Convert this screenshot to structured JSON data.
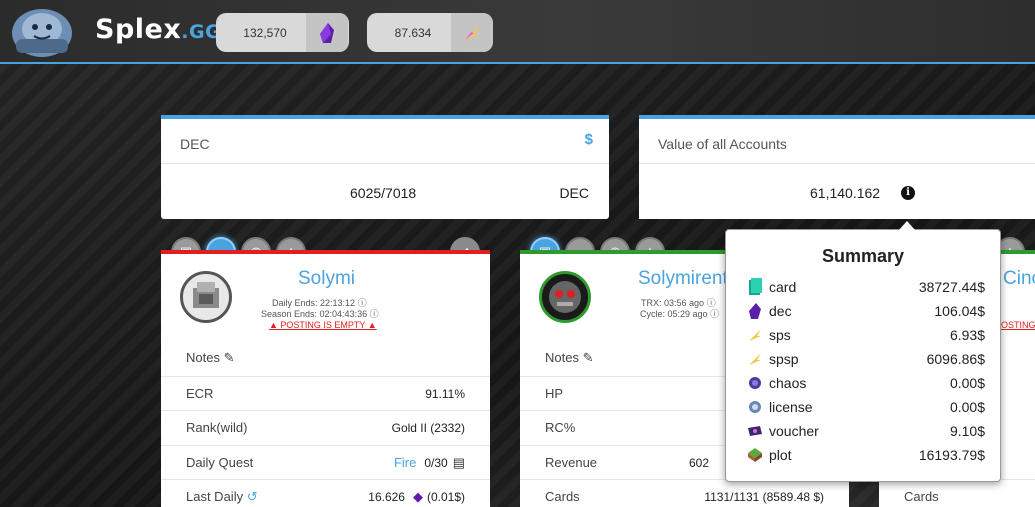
{
  "header": {
    "brand": "Splex",
    "brand_suffix": ".GG",
    "balance_dec": "132,570",
    "balance_sps": "87.634"
  },
  "dec_card": {
    "title": "DEC",
    "dollar_icon": "$",
    "value": "6025/7018",
    "unit": "DEC"
  },
  "value_card": {
    "title": "Value of all Accounts",
    "value": "61,140.162"
  },
  "account1": {
    "name": "Solymi",
    "daily_ends": "Daily Ends: 22:13:12",
    "season_ends": "Season Ends: 02:04:43:36",
    "warning": "POSTING IS EMPTY",
    "rows": {
      "notes": "Notes",
      "ecr_label": "ECR",
      "ecr_value": "91.11%",
      "rank_label": "Rank(wild)",
      "rank_value": "Gold II (2332)",
      "quest_label": "Daily Quest",
      "quest_type": "Fire",
      "quest_value": "0/30",
      "last_daily_label": "Last Daily",
      "last_daily_value": "16.626",
      "last_daily_usd": "(0.01$)"
    },
    "topbar_color": "#e02020"
  },
  "account2": {
    "name": "Solymirent",
    "trx": "TRX: 03:56 ago",
    "cycle": "Cycle: 05:29 ago",
    "rows": {
      "notes": "Notes",
      "hp_label": "HP",
      "rc_label": "RC%",
      "revenue_label": "Revenue",
      "revenue_value": "602",
      "cards_label": "Cards",
      "cards_value": "1131/1131 (8589.48 $)"
    },
    "topbar_color": "#2e9a2e"
  },
  "account3": {
    "name": "Cinc",
    "warning": "POSTING",
    "cards_label": "Cards"
  },
  "summary": {
    "title": "Summary",
    "items": [
      {
        "name": "card",
        "value": "38727.44$",
        "icon": "card-icon"
      },
      {
        "name": "dec",
        "value": "106.04$",
        "icon": "dec-icon"
      },
      {
        "name": "sps",
        "value": "6.93$",
        "icon": "sps-icon"
      },
      {
        "name": "spsp",
        "value": "6096.86$",
        "icon": "spsp-icon"
      },
      {
        "name": "chaos",
        "value": "0.00$",
        "icon": "chaos-icon"
      },
      {
        "name": "license",
        "value": "0.00$",
        "icon": "license-icon"
      },
      {
        "name": "voucher",
        "value": "9.10$",
        "icon": "voucher-icon"
      },
      {
        "name": "plot",
        "value": "16193.79$",
        "icon": "plot-icon"
      }
    ]
  }
}
